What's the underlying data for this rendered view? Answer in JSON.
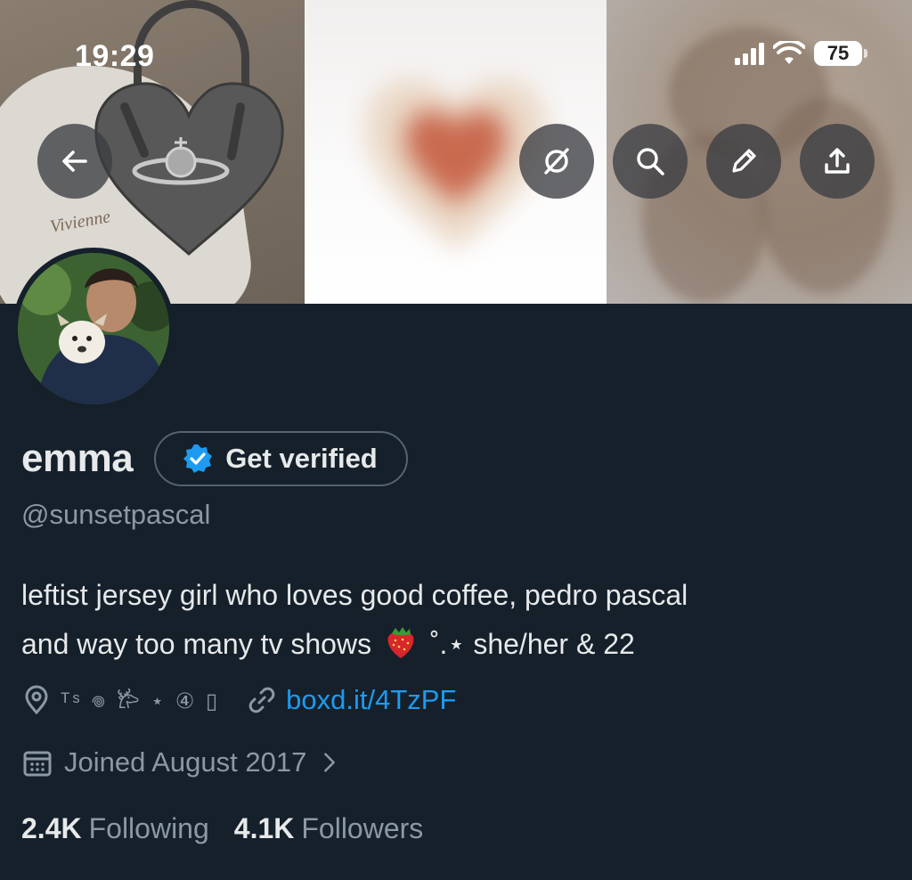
{
  "status_bar": {
    "time": "19:29",
    "battery": "75"
  },
  "header": {
    "banner_images": [
      "vivienne-westwood-heart-bag",
      "blurred-heart",
      "abstract-stain"
    ],
    "dustbag_text": "Vivienne"
  },
  "profile": {
    "display_name": "emma",
    "verify_label": "Get verified",
    "handle": "@sunsetpascal",
    "bio_line1": "leftist jersey girl who loves good coffee, pedro pascal",
    "bio_line2_before": "and way too many tv shows",
    "bio_line2_after": "˚.⋆ she/her & 22",
    "location": "ᵀˢ 𖦹 𐂂 ⋆ ④ ▯",
    "link": "boxd.it/4TzPF",
    "joined": "Joined August 2017",
    "following_count": "2.4K",
    "following_label": "Following",
    "followers_count": "4.1K",
    "followers_label": "Followers"
  },
  "colors": {
    "background": "#15202b",
    "accent": "#1d9bf0",
    "secondary_text": "#8b98a5"
  }
}
